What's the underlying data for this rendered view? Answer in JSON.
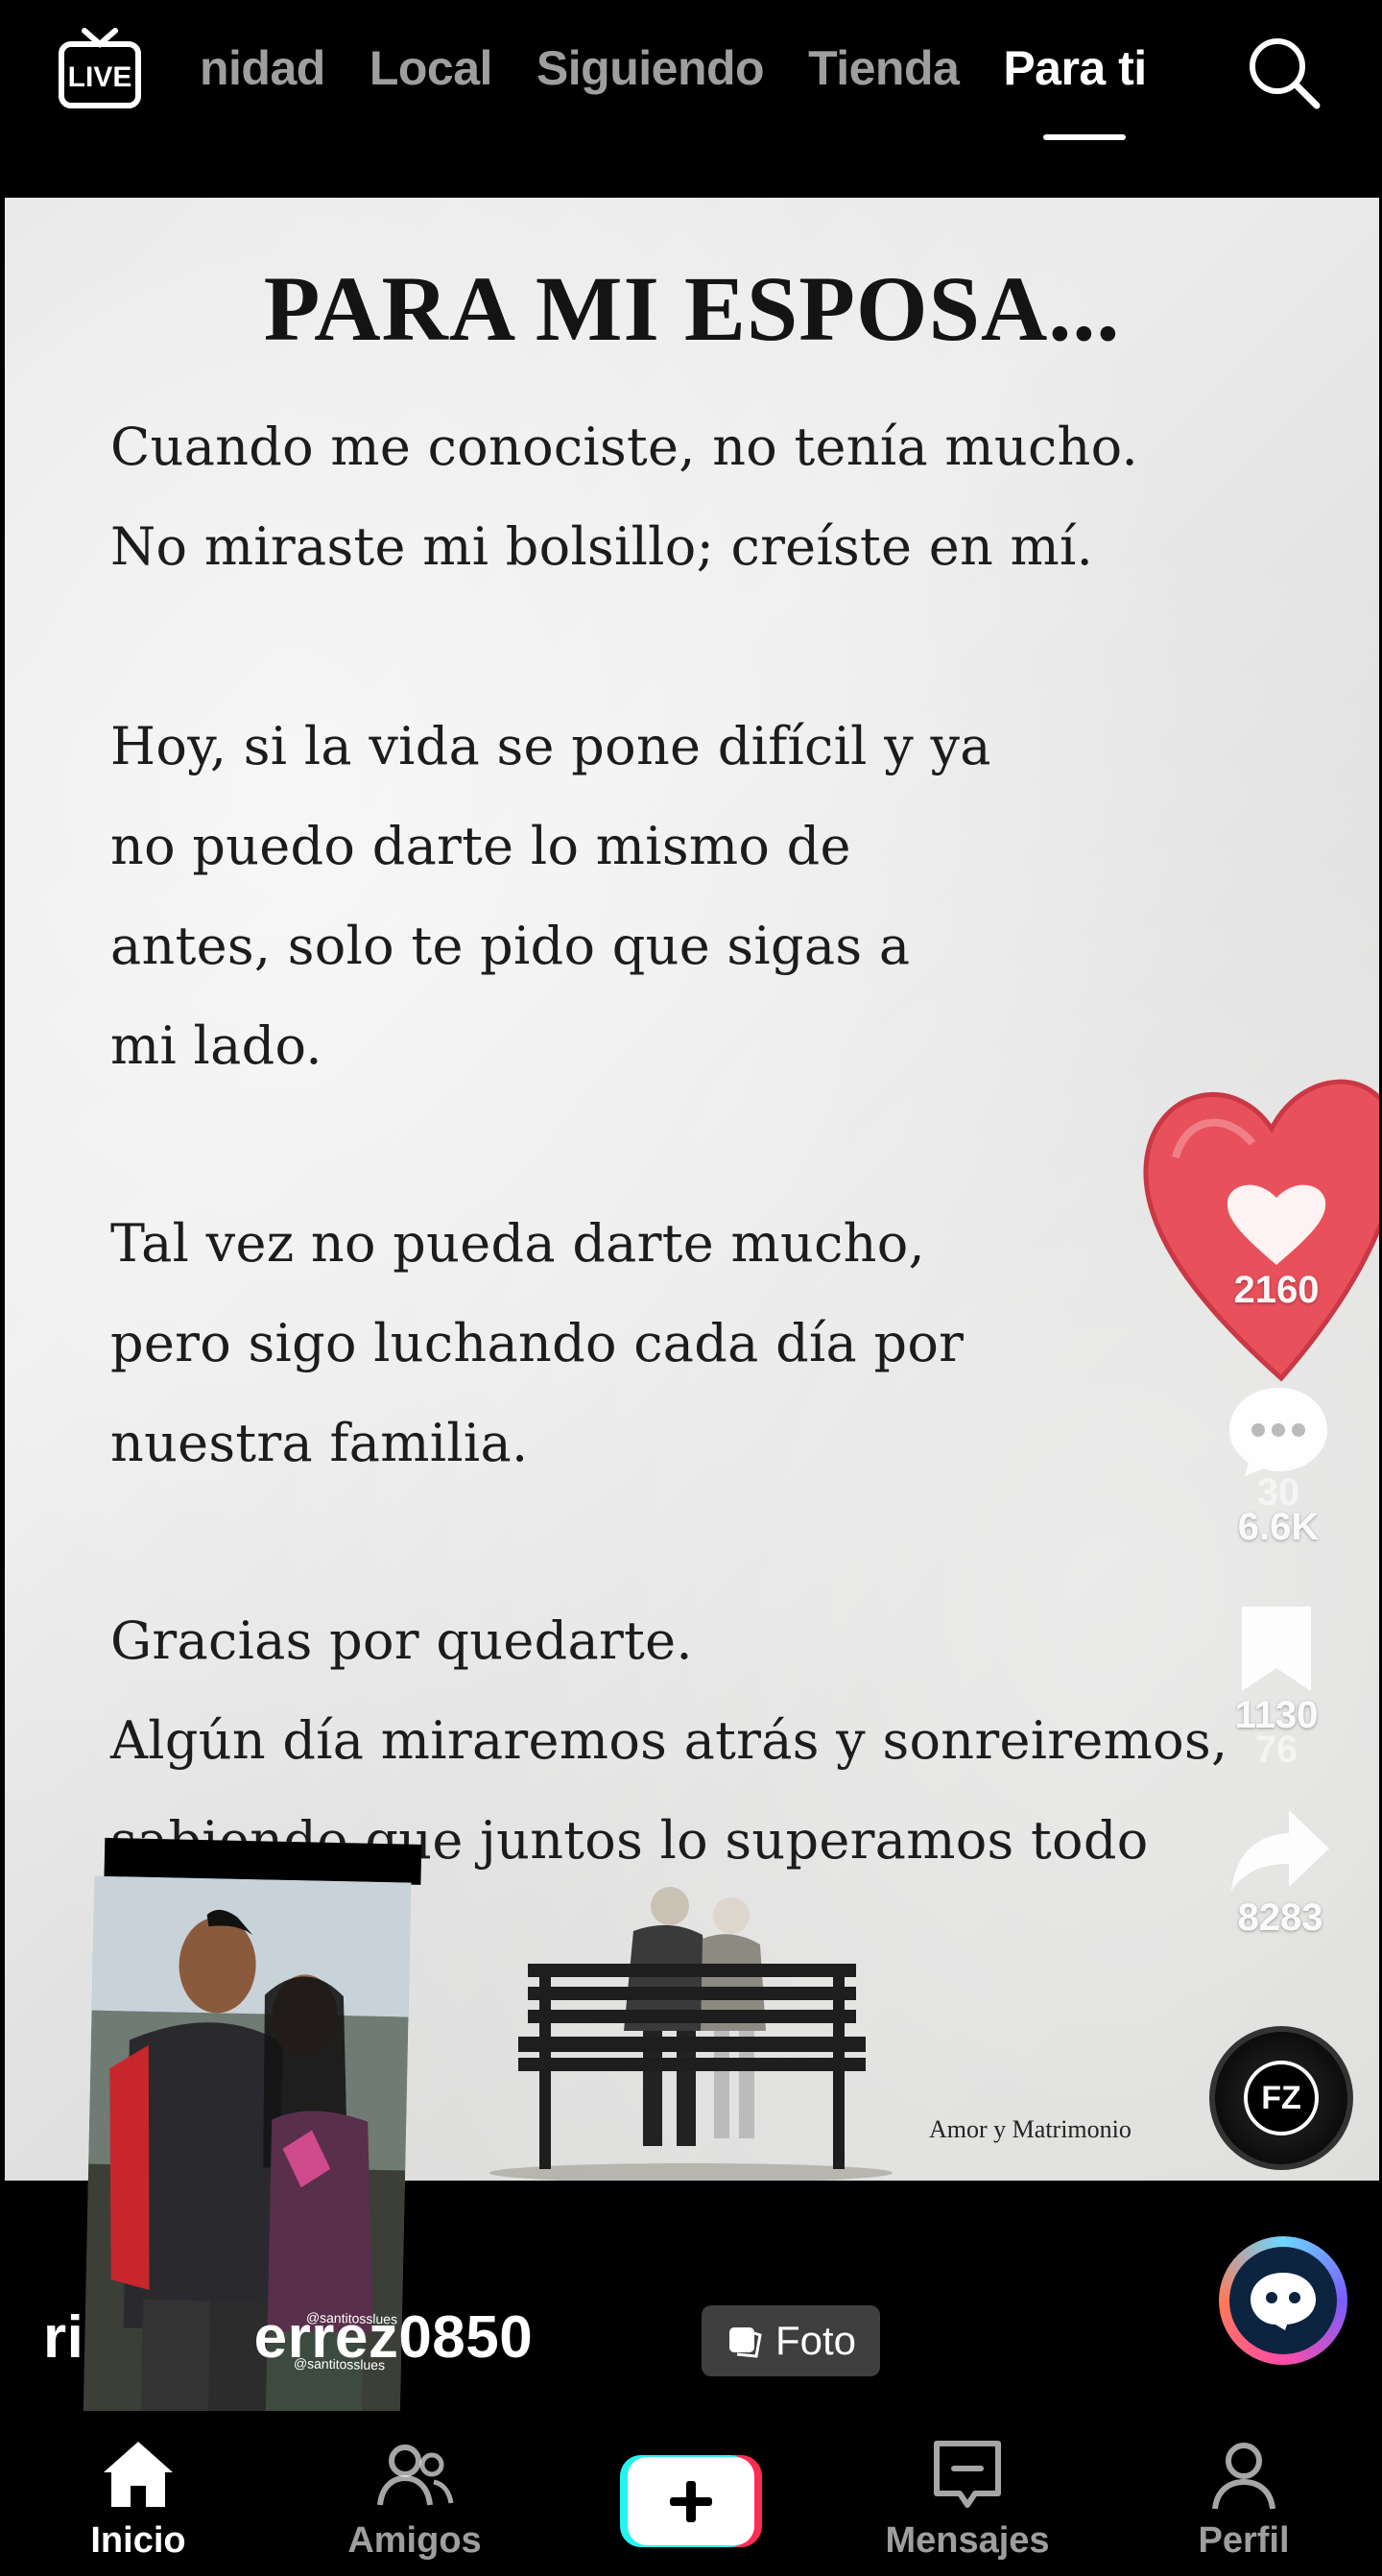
{
  "top_bar": {
    "live_label": "LIVE",
    "tabs": [
      {
        "label": "nidad",
        "active": false
      },
      {
        "label": "Local",
        "active": false
      },
      {
        "label": "Siguiendo",
        "active": false
      },
      {
        "label": "Tienda",
        "active": false
      },
      {
        "label": "Para ti",
        "active": true
      }
    ],
    "search_icon": "search-icon"
  },
  "post": {
    "title": "PARA MI ESPOSA...",
    "lines": [
      "Cuando me conociste, no tenía mucho.",
      "No miraste mi bolsillo; creíste en mí.",
      "Hoy, si la vida se pone difícil y ya",
      "no puedo darte lo mismo de",
      "antes, solo te pido que sigas a",
      "mi lado.",
      "Tal vez no pueda darte mucho,",
      "pero sigo luchando cada día por",
      "nuestra familia.",
      "Gracias por quedarte.",
      "Algún día miraremos atrás y sonreiremos,",
      "sabiendo que juntos lo superamos todo"
    ],
    "watermark": "Amor y Matrimonio"
  },
  "actions": {
    "like_count": "2160",
    "comment_count": "6.6K",
    "comment_ghost": "30",
    "save_count": "1130",
    "save_ghost": "76",
    "share_count": "8283",
    "music_label": "FZ"
  },
  "overlay": {
    "username": "ri          errez0850",
    "photo_tag_1": "@santitosslues",
    "photo_tag_2": "@santitosslues",
    "foto_chip": "Foto"
  },
  "bottom_nav": {
    "items": [
      {
        "label": "Inicio",
        "icon": "home-icon",
        "active": true
      },
      {
        "label": "Amigos",
        "icon": "friends-icon",
        "active": false
      },
      {
        "label": "",
        "icon": "create-plus-icon",
        "active": false
      },
      {
        "label": "Mensajes",
        "icon": "inbox-icon",
        "active": false
      },
      {
        "label": "Perfil",
        "icon": "profile-icon",
        "active": false
      }
    ]
  },
  "colors": {
    "background": "#000000",
    "create_cyan": "#25f4ee",
    "create_pink": "#fe2c55",
    "heart_red": "#e8505b"
  }
}
